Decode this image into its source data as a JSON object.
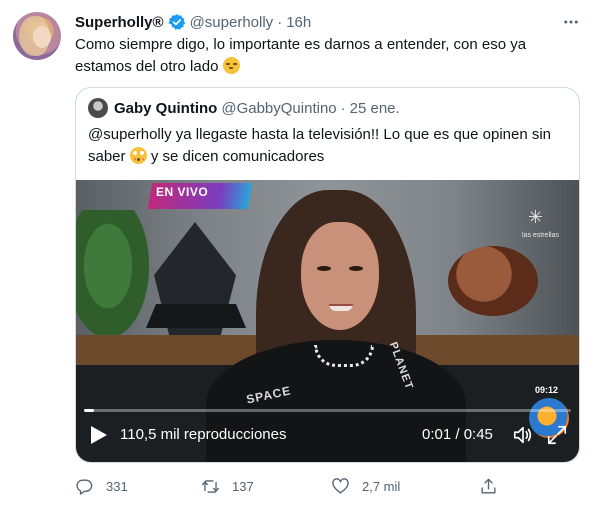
{
  "tweet": {
    "author_name": "Superholly®",
    "handle": "@superholly",
    "separator": "·",
    "time": "16h",
    "text_main": "Como siempre digo, lo importante es darnos a entender, con eso ya estamos del otro lado",
    "emoji": "smirking-face",
    "verified_color": "#1d9bf0"
  },
  "quote": {
    "author_name": "Gaby Quintino",
    "handle": "@GabbyQuintino",
    "separator": "·",
    "date": "25 ene.",
    "text_part1": "@superholly ya llegaste hasta la televisión!! Lo que es que opinen sin saber",
    "emoji": "flushed-face",
    "text_part2": "y se dicen comunicadores"
  },
  "video": {
    "overlay_banner": "EN VIVO",
    "channel_logo_text": "las estrellas",
    "clock": "09:12",
    "shirt_text_1": "SPACE",
    "shirt_text_2": "PLANET",
    "views": "110,5 mil reproducciones",
    "timecode": "0:01 / 0:45",
    "progress": 0.02
  },
  "actions": {
    "replies": "331",
    "retweets": "137",
    "likes": "2,7 mil"
  },
  "colors": {
    "text_primary": "#0f1419",
    "text_secondary": "#536471",
    "border": "#cfd9de",
    "accent": "#1d9bf0"
  }
}
